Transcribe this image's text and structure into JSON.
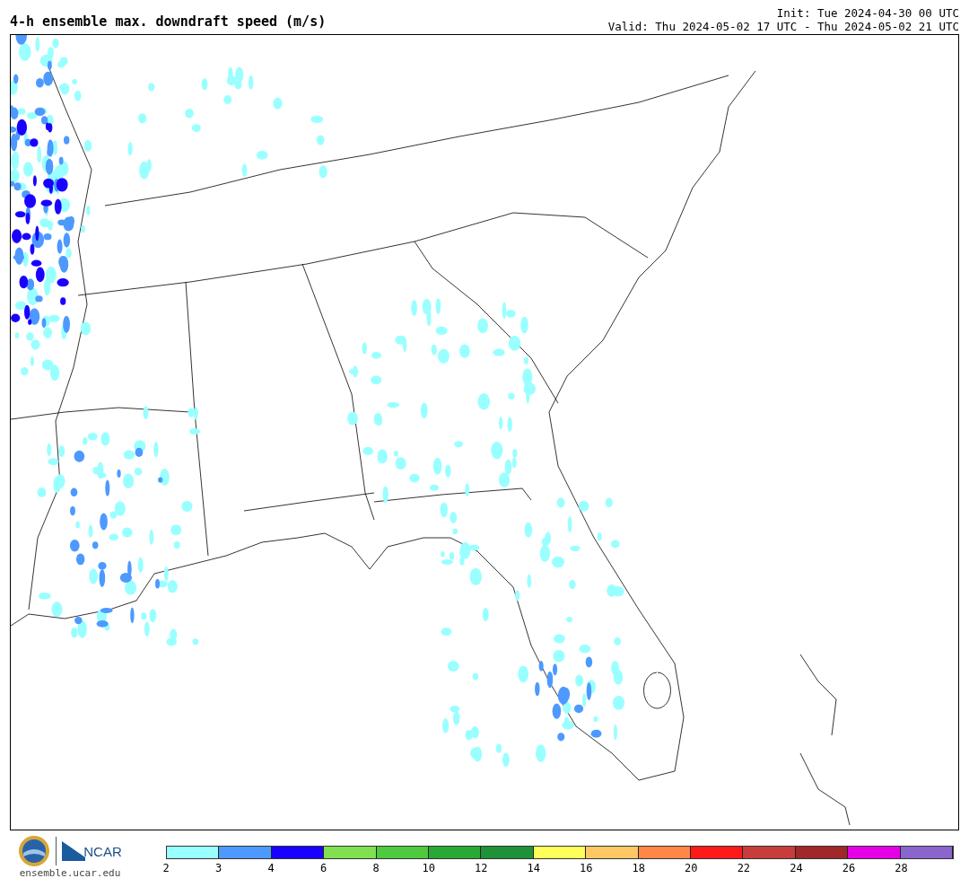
{
  "title": "4-h ensemble max. downdraft speed (m/s)",
  "init": "Init: Tue 2024-04-30 00 UTC",
  "valid": "Valid: Thu 2024-05-02 17 UTC - Thu 2024-05-02 21 UTC",
  "footer": {
    "logo_text": "NCAR",
    "url": "ensemble.ucar.edu"
  },
  "colorbar": {
    "segments": [
      {
        "color": "#99ffff"
      },
      {
        "color": "#4d99ff"
      },
      {
        "color": "#1a00ff"
      },
      {
        "color": "#80e050"
      },
      {
        "color": "#4ec940"
      },
      {
        "color": "#2aa835"
      },
      {
        "color": "#1f9138"
      },
      {
        "color": "#ffff5a"
      },
      {
        "color": "#ffc864"
      },
      {
        "color": "#ff8848"
      },
      {
        "color": "#ff1a1a"
      },
      {
        "color": "#c83c3c"
      },
      {
        "color": "#a02828"
      },
      {
        "color": "#e600e6"
      },
      {
        "color": "#8a66cc"
      }
    ],
    "ticks": [
      "2",
      "3",
      "4",
      "6",
      "8",
      "10",
      "12",
      "14",
      "16",
      "18",
      "20",
      "22",
      "24",
      "26",
      "28"
    ]
  }
}
